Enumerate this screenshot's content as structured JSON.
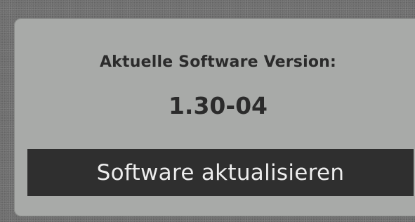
{
  "panel": {
    "label": "Aktuelle Software Version:",
    "version": "1.30-04",
    "update_button_label": "Software aktualisieren"
  },
  "colors": {
    "background": "#6f6f6f",
    "panel": "#a8aaa8",
    "button": "#2f2f2f",
    "button_text": "#ededed",
    "text": "#2b2b2b"
  }
}
